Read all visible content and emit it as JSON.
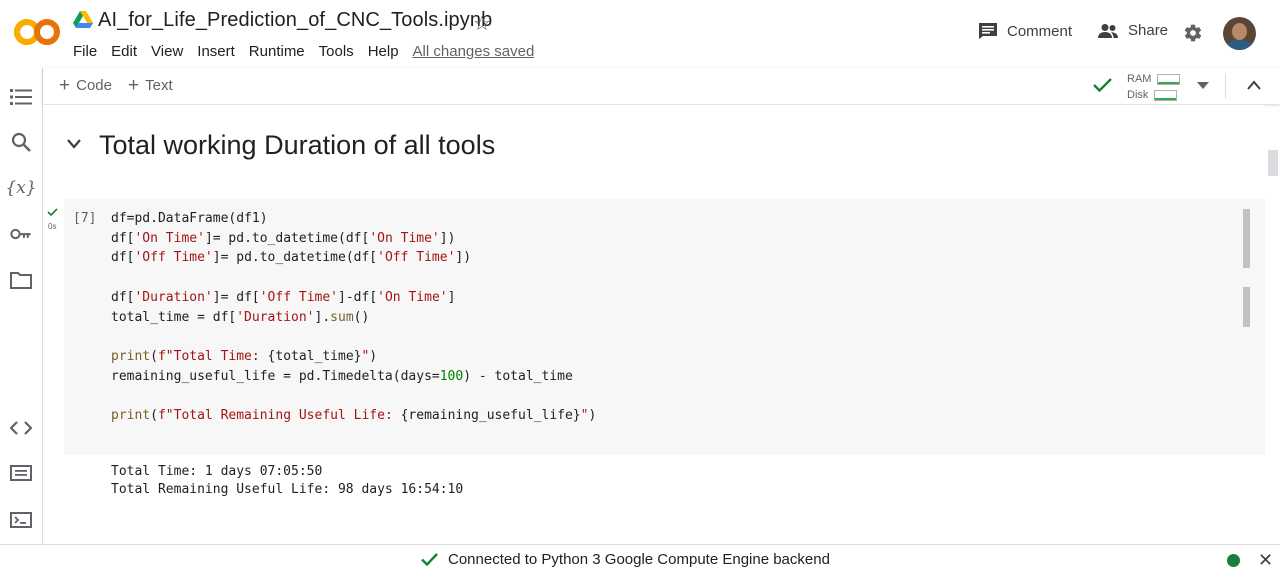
{
  "header": {
    "notebook_title": "AI_for_Life_Prediction_of_CNC_Tools.ipynb",
    "menu": [
      "File",
      "Edit",
      "View",
      "Insert",
      "Runtime",
      "Tools",
      "Help"
    ],
    "saved_status": "All changes saved",
    "comment_label": "Comment",
    "share_label": "Share"
  },
  "toolbar": {
    "code_label": "Code",
    "text_label": "Text",
    "ram_label": "RAM",
    "disk_label": "Disk"
  },
  "sidebar": {
    "icons": [
      "table-of-contents-icon",
      "search-icon",
      "variables-icon",
      "secrets-key-icon",
      "files-folder-icon",
      "code-snippets-icon",
      "command-palette-icon",
      "terminal-icon"
    ]
  },
  "section": {
    "title": "Total working Duration of all tools"
  },
  "cell": {
    "execution_count": "[7]",
    "exec_time": "0s",
    "code_lines": [
      "df=pd.DataFrame(df1)",
      "df['On Time']= pd.to_datetime(df['On Time'])",
      "df['Off Time']= pd.to_datetime(df['Off Time'])",
      "",
      "df['Duration']= df['Off Time']-df['On Time']",
      "total_time = df['Duration'].sum()",
      "",
      "print(f\"Total Time: {total_time}\")",
      "remaining_useful_life = pd.Timedelta(days=100) - total_time",
      "",
      "print(f\"Total Remaining Useful Life: {remaining_useful_life}\")"
    ],
    "output_lines": [
      "Total Time: 1 days 07:05:50",
      "Total Remaining Useful Life: 98 days 16:54:10"
    ]
  },
  "status": {
    "text": "Connected to Python 3 Google Compute Engine backend",
    "colors": {
      "connected": "#188038",
      "accent": "#f9ab00"
    }
  }
}
